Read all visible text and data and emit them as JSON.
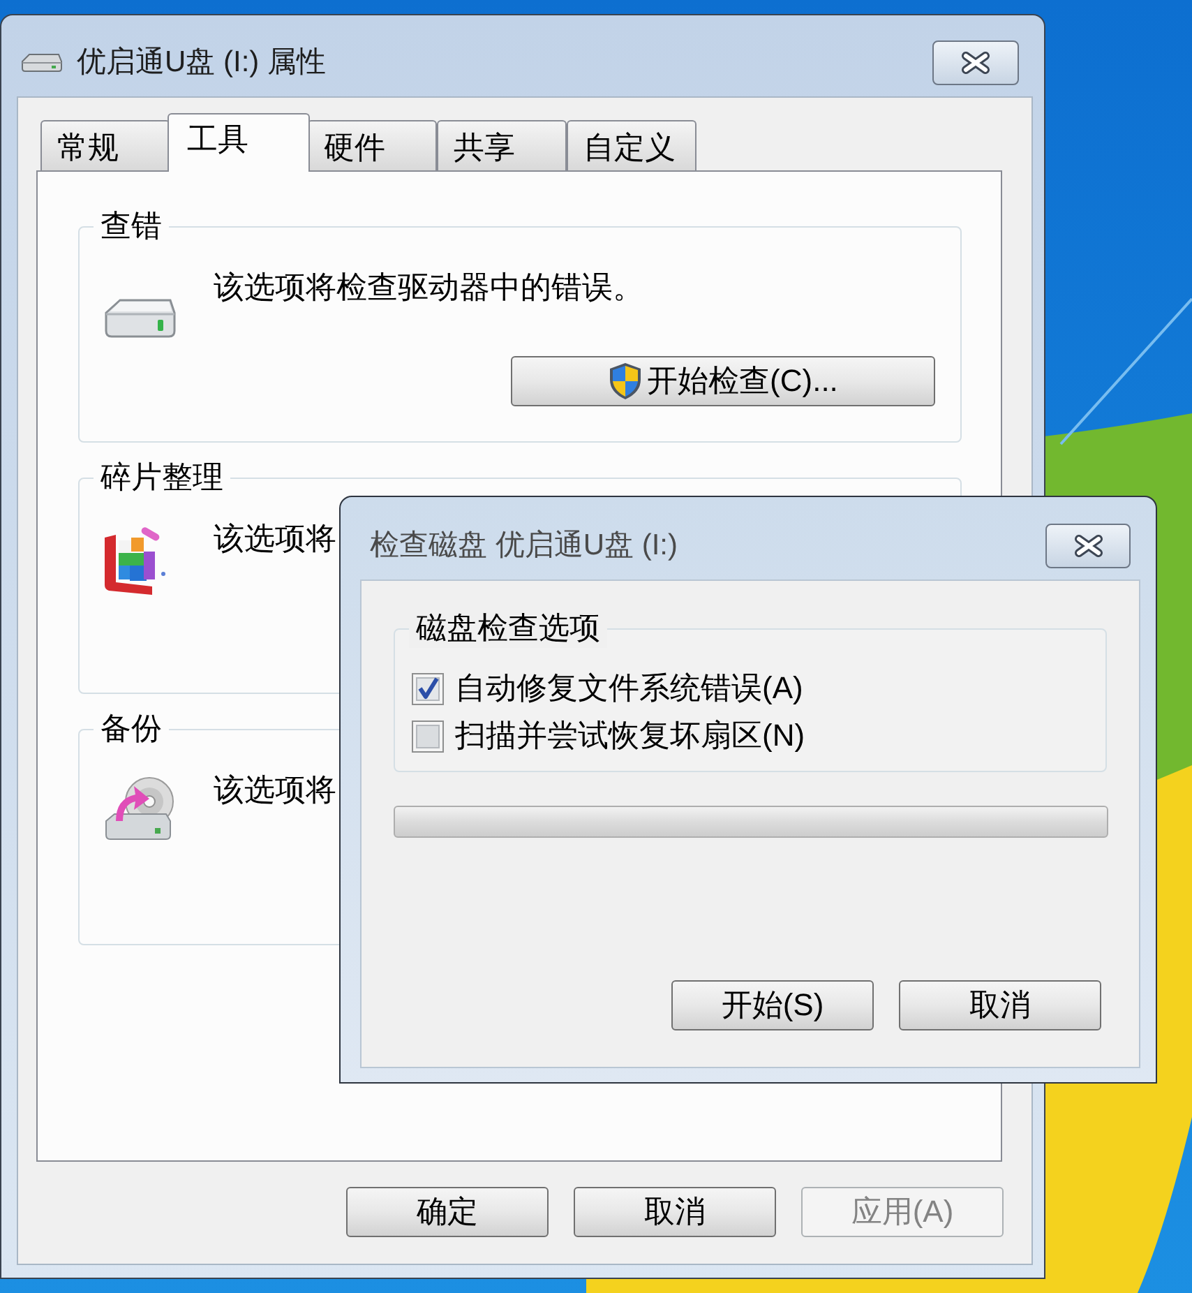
{
  "properties_window": {
    "title": "优启通U盘 (I:) 属性",
    "tabs": [
      {
        "label": "常规",
        "selected": false
      },
      {
        "label": "工具",
        "selected": true
      },
      {
        "label": "硬件",
        "selected": false
      },
      {
        "label": "共享",
        "selected": false
      },
      {
        "label": "自定义",
        "selected": false
      }
    ],
    "groups": [
      {
        "kind": "check",
        "title": "查错",
        "text": "该选项将检查驱动器中的错误。",
        "button": "开始检查(C)..."
      },
      {
        "kind": "defrag",
        "title": "碎片整理",
        "text": "该选项将"
      },
      {
        "kind": "backup",
        "title": "备份",
        "text": "该选项将"
      }
    ],
    "buttons": [
      {
        "label": "确定",
        "disabled": false
      },
      {
        "label": "取消",
        "disabled": false
      },
      {
        "label": "应用(A)",
        "disabled": true
      }
    ]
  },
  "check_disk_dialog": {
    "title": "检查磁盘 优启通U盘 (I:)",
    "group_title": "磁盘检查选项",
    "options": [
      {
        "label": "自动修复文件系统错误(A)",
        "checked": true
      },
      {
        "label": "扫描并尝试恢复坏扇区(N)",
        "checked": false
      }
    ],
    "progress": {
      "level": 0
    },
    "buttons": [
      "开始(S)",
      "取消"
    ]
  }
}
